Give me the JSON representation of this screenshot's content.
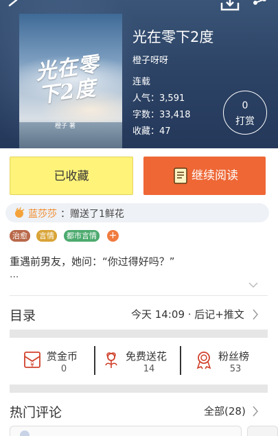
{
  "header": {
    "book_title": "光在零下2度",
    "author": "橙子呀呀",
    "status": "连载",
    "popularity_label": "人气：",
    "popularity_value": "3,591",
    "word_count_label": "字数：",
    "word_count_value": "33,418",
    "favorites_label": "收藏：",
    "favorites_value": "47",
    "reward_count": "0",
    "reward_label": "打赏",
    "cover_title": "光在零下2度",
    "cover_author": "橙子 著"
  },
  "actions": {
    "collected_label": "已收藏",
    "read_label": "继续阅读"
  },
  "gift_banner": {
    "user": "蓝莎莎",
    "text": "：赠送了1鲜花"
  },
  "tags": [
    {
      "label": "治愈",
      "color": "#b9694a"
    },
    {
      "label": "言情",
      "color": "#d9a437"
    },
    {
      "label": "都市言情",
      "color": "#4caa6e"
    }
  ],
  "tag_add_label": "+",
  "summary": {
    "text": "重遇前男友，她问：“你过得好吗？”",
    "ellipsis": "..."
  },
  "catalog": {
    "title": "目录",
    "update": "今天 14:09 · 后记+推文"
  },
  "stats": [
    {
      "label": "赏金币",
      "value": "0",
      "icon": "coin-envelope-icon"
    },
    {
      "label": "免费送花",
      "value": "14",
      "icon": "flower-icon"
    },
    {
      "label": "粉丝榜",
      "value": "53",
      "icon": "medal-icon"
    }
  ],
  "hot_comments": {
    "title": "热门评论",
    "all_label": "全部(28)"
  },
  "colors": {
    "header_bg": "#2d4466",
    "collected_bg": "#fff37a",
    "read_bg": "#ee6735",
    "gift_user": "#f08a2c",
    "icon_red": "#d0402a"
  }
}
